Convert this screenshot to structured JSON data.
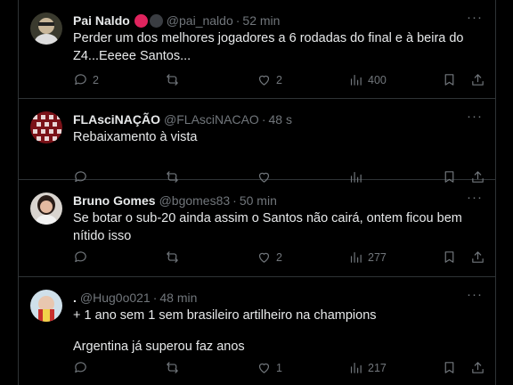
{
  "colors": {
    "background": "#000000",
    "text_primary": "#e7e9ea",
    "text_secondary": "#71767b",
    "divider": "#2f3336",
    "badge_red": "#e0245e",
    "badge_dark": "#3a3d42"
  },
  "tweets": [
    {
      "name": "Pai Naldo",
      "handle": "@pai_naldo",
      "separator": "·",
      "time": "52 min",
      "text_lines": [
        "Perder um dos melhores jogadores a 6 rodadas do final e à beira do Z4...Eeeee Santos..."
      ],
      "replies": "2",
      "reposts": "",
      "likes": "2",
      "views": "400",
      "more": "···"
    },
    {
      "name": "FLAsciNAÇÃO",
      "handle": "@FLAsciNACAO",
      "separator": "·",
      "time": "48 s",
      "text_lines": [
        "Rebaixamento à vista"
      ],
      "replies": "",
      "reposts": "",
      "likes": "",
      "views": "",
      "more": "···"
    },
    {
      "name": "Bruno Gomes",
      "handle": "@bgomes83",
      "separator": "·",
      "time": "50 min",
      "text_lines": [
        "Se botar o sub-20 ainda assim o Santos não cairá, ontem ficou bem nítido isso"
      ],
      "replies": "",
      "reposts": "",
      "likes": "2",
      "views": "277",
      "more": "···"
    },
    {
      "name": ".",
      "handle": "@Hug0o021",
      "separator": "·",
      "time": "48 min",
      "text_lines": [
        "+ 1 ano sem 1 sem brasileiro artilheiro na champions",
        "Argentina já superou faz anos"
      ],
      "replies": "",
      "reposts": "",
      "likes": "1",
      "views": "217",
      "more": "···"
    }
  ]
}
